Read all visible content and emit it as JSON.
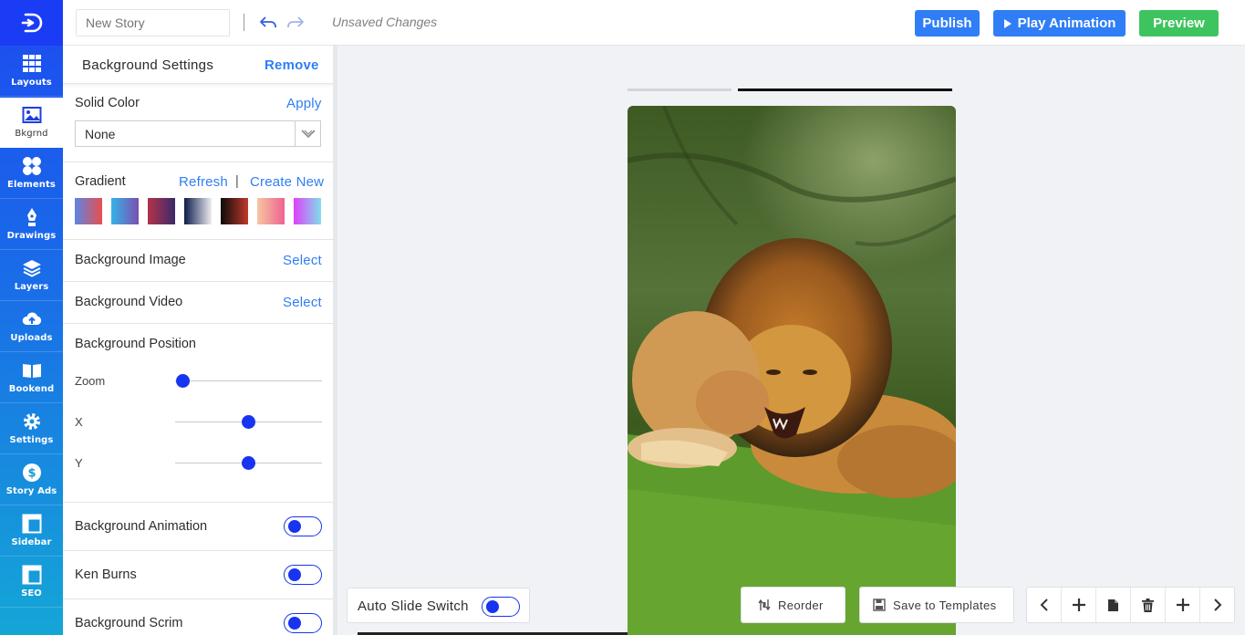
{
  "app": {
    "story_name_placeholder": "New Story",
    "unsaved_text": "Unsaved Changes",
    "accent_color": "#1734f0",
    "publish_label": "Publish",
    "play_label": "Play Animation",
    "preview_label": "Preview"
  },
  "sidebar": {
    "items": [
      {
        "label": "Layouts",
        "icon": "grid-icon"
      },
      {
        "label": "Bkgrnd",
        "icon": "image-icon",
        "active": true
      },
      {
        "label": "Elements",
        "icon": "shapes-icon"
      },
      {
        "label": "Drawings",
        "icon": "pen-icon"
      },
      {
        "label": "Layers",
        "icon": "layers-icon"
      },
      {
        "label": "Uploads",
        "icon": "cloud-upload-icon"
      },
      {
        "label": "Bookend",
        "icon": "book-icon"
      },
      {
        "label": "Settings",
        "icon": "gear-icon"
      },
      {
        "label": "Story Ads",
        "icon": "dollar-icon"
      },
      {
        "label": "Sidebar",
        "icon": "sidebar-icon"
      },
      {
        "label": "SEO",
        "icon": "seo-icon"
      }
    ]
  },
  "panel": {
    "title": "Background Settings",
    "remove_label": "Remove",
    "solid_color": {
      "label": "Solid Color",
      "apply_label": "Apply",
      "value": "None"
    },
    "gradient": {
      "label": "Gradient",
      "refresh_label": "Refresh",
      "separator": "|",
      "create_label": "Create New",
      "swatches": [
        {
          "from": "#5b86e5",
          "to": "#e94d4d"
        },
        {
          "from": "#36b3e8",
          "to": "#7b4fb0"
        },
        {
          "from": "#b3334a",
          "to": "#3b2a6b"
        },
        {
          "from": "#0d1b4a",
          "to": "#eeeef2"
        },
        {
          "from": "#0b0b0b",
          "to": "#c0392b"
        },
        {
          "from": "#f5c6a0",
          "to": "#f06292"
        },
        {
          "from": "#e040fb",
          "to": "#80deea"
        }
      ]
    },
    "image": {
      "label": "Background Image",
      "select_label": "Select"
    },
    "video": {
      "label": "Background Video",
      "select_label": "Select"
    },
    "position": {
      "label": "Background Position",
      "zoom_label": "Zoom",
      "x_label": "X",
      "y_label": "Y",
      "zoom_value": 0.05,
      "x_value": 0.5,
      "y_value": 0.5
    },
    "animation": {
      "label": "Background Animation",
      "on": false
    },
    "ken_burns": {
      "label": "Ken Burns",
      "on": false
    },
    "scrim": {
      "label": "Background Scrim",
      "on": false
    }
  },
  "canvas": {
    "auto_slide_label": "Auto Slide Switch",
    "reorder_label": "Reorder",
    "save_templates_label": "Save to Templates"
  }
}
